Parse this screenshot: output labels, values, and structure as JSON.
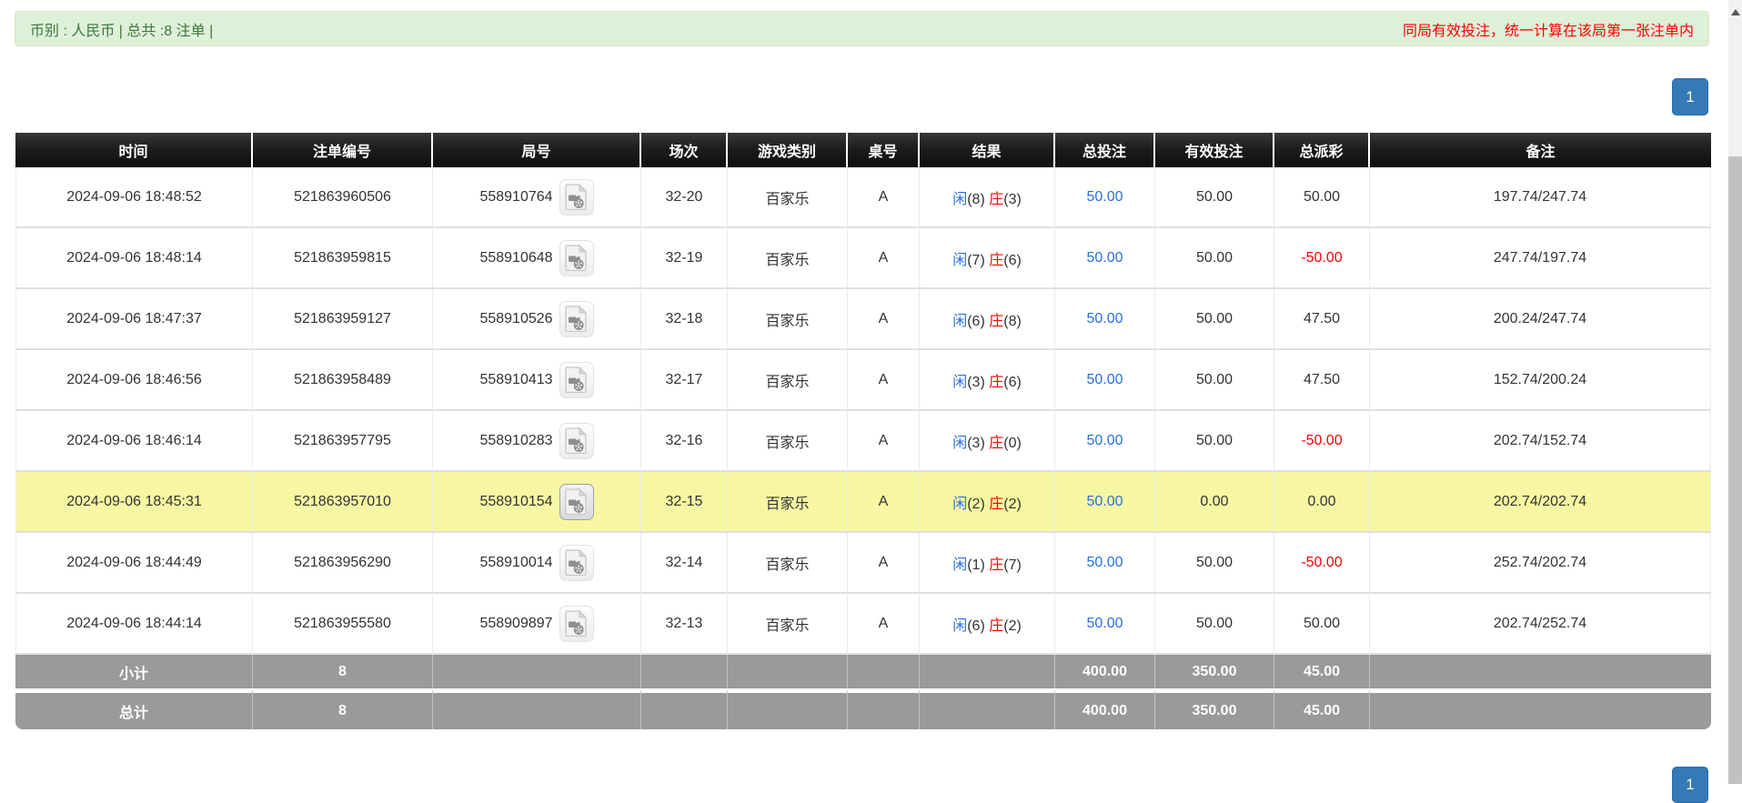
{
  "top_bar": {
    "summary": "币别 : 人民币 | 总共 :8 注单 |",
    "notice": "同局有效投注，统一计算在该局第一张注单内"
  },
  "pagination": {
    "page": "1"
  },
  "icons": {
    "video_icon": "video-file-icon",
    "scroll_up_icon": "up-arrow-icon"
  },
  "colors": {
    "alert_bg": "#dff0d8",
    "alert_text": "#3c763d",
    "notice_red": "#ff0000",
    "header_bg": "#1d1d1d",
    "link_blue": "#2a6fdb",
    "negative_red": "#ff0000",
    "highlight_yellow": "#f7f7a3",
    "totals_grey": "#9a9a9a",
    "pager_blue": "#337ab7"
  },
  "table": {
    "headers": [
      "时间",
      "注单编号",
      "局号",
      "场次",
      "游戏类别",
      "桌号",
      "结果",
      "总投注",
      "有效投注",
      "总派彩",
      "备注"
    ],
    "result_labels": {
      "player": "闲",
      "banker": "庄"
    },
    "rows": [
      {
        "time": "2024-09-06 18:48:52",
        "bet_id": "521863960506",
        "round": "558910764",
        "session": "32-20",
        "game": "百家乐",
        "table_no": "A",
        "player_points": "8",
        "banker_points": "3",
        "total_bet": "50.00",
        "valid_bet": "50.00",
        "payout": "50.00",
        "remark": "197.74/247.74",
        "highlight": false
      },
      {
        "time": "2024-09-06 18:48:14",
        "bet_id": "521863959815",
        "round": "558910648",
        "session": "32-19",
        "game": "百家乐",
        "table_no": "A",
        "player_points": "7",
        "banker_points": "6",
        "total_bet": "50.00",
        "valid_bet": "50.00",
        "payout": "-50.00",
        "remark": "247.74/197.74",
        "highlight": false
      },
      {
        "time": "2024-09-06 18:47:37",
        "bet_id": "521863959127",
        "round": "558910526",
        "session": "32-18",
        "game": "百家乐",
        "table_no": "A",
        "player_points": "6",
        "banker_points": "8",
        "total_bet": "50.00",
        "valid_bet": "50.00",
        "payout": "47.50",
        "remark": "200.24/247.74",
        "highlight": false
      },
      {
        "time": "2024-09-06 18:46:56",
        "bet_id": "521863958489",
        "round": "558910413",
        "session": "32-17",
        "game": "百家乐",
        "table_no": "A",
        "player_points": "3",
        "banker_points": "6",
        "total_bet": "50.00",
        "valid_bet": "50.00",
        "payout": "47.50",
        "remark": "152.74/200.24",
        "highlight": false
      },
      {
        "time": "2024-09-06 18:46:14",
        "bet_id": "521863957795",
        "round": "558910283",
        "session": "32-16",
        "game": "百家乐",
        "table_no": "A",
        "player_points": "3",
        "banker_points": "0",
        "total_bet": "50.00",
        "valid_bet": "50.00",
        "payout": "-50.00",
        "remark": "202.74/152.74",
        "highlight": false
      },
      {
        "time": "2024-09-06 18:45:31",
        "bet_id": "521863957010",
        "round": "558910154",
        "session": "32-15",
        "game": "百家乐",
        "table_no": "A",
        "player_points": "2",
        "banker_points": "2",
        "total_bet": "50.00",
        "valid_bet": "0.00",
        "payout": "0.00",
        "remark": "202.74/202.74",
        "highlight": true
      },
      {
        "time": "2024-09-06 18:44:49",
        "bet_id": "521863956290",
        "round": "558910014",
        "session": "32-14",
        "game": "百家乐",
        "table_no": "A",
        "player_points": "1",
        "banker_points": "7",
        "total_bet": "50.00",
        "valid_bet": "50.00",
        "payout": "-50.00",
        "remark": "252.74/202.74",
        "highlight": false
      },
      {
        "time": "2024-09-06 18:44:14",
        "bet_id": "521863955580",
        "round": "558909897",
        "session": "32-13",
        "game": "百家乐",
        "table_no": "A",
        "player_points": "6",
        "banker_points": "2",
        "total_bet": "50.00",
        "valid_bet": "50.00",
        "payout": "50.00",
        "remark": "202.74/252.74",
        "highlight": false
      }
    ],
    "subtotal": {
      "label": "小计",
      "count": "8",
      "total_bet": "400.00",
      "valid_bet": "350.00",
      "payout": "45.00"
    },
    "total": {
      "label": "总计",
      "count": "8",
      "total_bet": "400.00",
      "valid_bet": "350.00",
      "payout": "45.00"
    }
  }
}
